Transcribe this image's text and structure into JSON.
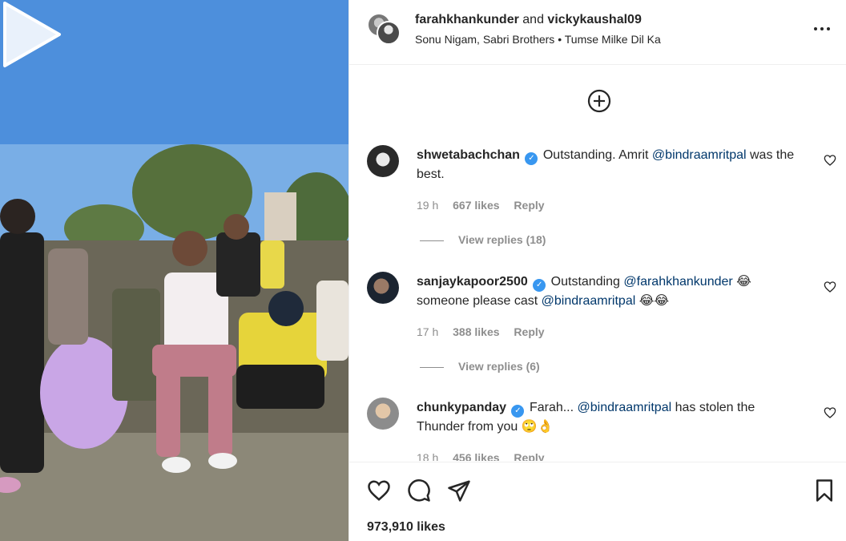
{
  "post": {
    "user_primary": "farahkhankunder",
    "joiner": "and",
    "user_secondary": "vickykaushal09",
    "audio_artists": "Sonu Nigam, Sabri Brothers",
    "separator": "•",
    "audio_title": "Tumse Milke Dil Ka",
    "more_icon": "more-horizontal-icon",
    "likes_label": "973,910 likes"
  },
  "comments": [
    {
      "user": "shwetabachchan",
      "verified": true,
      "text_before": "Outstanding. Amrit",
      "mention": "@bindraamritpal",
      "text_after": "was the best.",
      "time": "19 h",
      "likes": "667 likes",
      "reply": "Reply",
      "view_replies": "View replies (18)"
    },
    {
      "user": "sanjaykapoor2500",
      "verified": true,
      "text_before": "Outstanding",
      "mention": "@farahkhankunder",
      "text_mid": "😂 someone please cast",
      "mention2": "@bindraamritpal",
      "text_after": "😂😂",
      "time": "17 h",
      "likes": "388 likes",
      "reply": "Reply",
      "view_replies": "View replies (6)"
    },
    {
      "user": "chunkypanday",
      "verified": true,
      "text_before": "Farah...",
      "mention": "@bindraamritpal",
      "text_after": "has stolen the Thunder from you 🙄👌",
      "time": "18 h",
      "likes": "456 likes",
      "reply": "Reply"
    }
  ],
  "icons": {
    "add": "add-circle-icon",
    "like": "heart-icon",
    "comment": "comment-icon",
    "share": "share-icon",
    "save": "bookmark-icon",
    "play": "play-icon"
  },
  "colors": {
    "text": "#262626",
    "secondary": "#8e8e8e",
    "mention": "#00376b",
    "verified": "#3897f0"
  }
}
